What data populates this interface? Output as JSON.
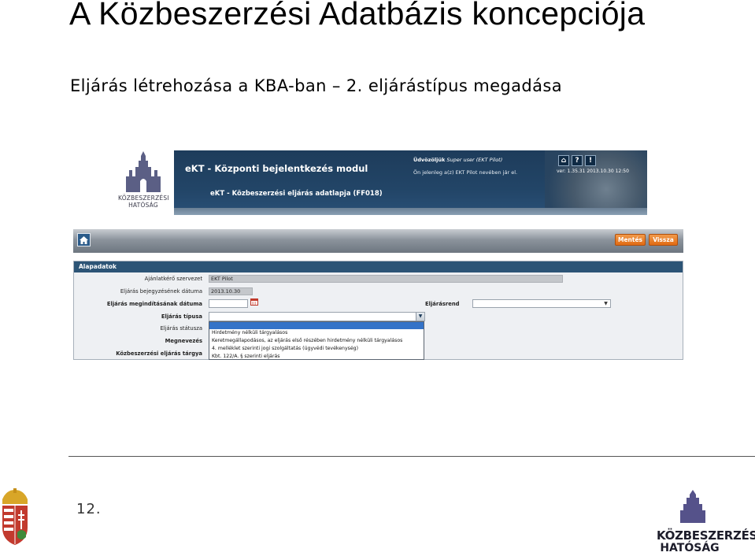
{
  "slide": {
    "title": "A Közbeszerzési Adatbázis koncepciója",
    "subtitle": "Eljárás létrehozása a KBA-ban – 2. eljárástípus megadása",
    "page_number": "12."
  },
  "logo": {
    "line1": "KÖZBESZERZÉSI",
    "line2": "HATÓSÁG"
  },
  "header": {
    "module_title": "eKT - Központi bejelentkezés modul",
    "form_title": "eKT - Közbeszerzési eljárás adatlapja (FF018)",
    "welcome_prefix": "Üdvözöljük",
    "welcome_user": "Super user (EKT Pilot)",
    "on_behalf": "Ön jelenleg a(z) EKT Pilot nevében jár el.",
    "version": "ver: 1.35.31 2013.10.30 12:50",
    "icons": [
      "home-icon",
      "help-icon",
      "alert-icon"
    ],
    "icon_labels": [
      "⌂",
      "?",
      "!"
    ]
  },
  "toolbar": {
    "save_label": "Mentés",
    "back_label": "Vissza"
  },
  "panel": {
    "title": "Alapadatok",
    "fields": {
      "contracting_label": "Ajánlatkérő szervezet",
      "contracting_value": "EKT Pilot",
      "registration_date_label": "Eljárás bejegyzésének dátuma",
      "registration_date_value": "2013.10.30",
      "start_date_label": "Eljárás megindításának dátuma",
      "start_date_value": "",
      "procedure_order_label": "Eljárásrend",
      "procedure_order_value": "",
      "procedure_type_label": "Eljárás típusa",
      "procedure_type_value": "",
      "procedure_status_label": "Eljárás státusza",
      "name_label": "Megnevezés",
      "subject_label": "Közbeszerzési eljárás tárgya"
    }
  },
  "dropdown": {
    "options": [
      "",
      "Hirdetmény nélküli tárgyalásos",
      "Keretmegállapodásos, az eljárás első részében hirdetmény nélküli tárgyalásos",
      "4. melléklet szerinti jogi szolgáltatás (ügyvédi tevékenység)",
      "Kbt. 122/A. § szerinti eljárás"
    ]
  },
  "colors": {
    "banner": "#1e3c5b",
    "panel_header": "#2c5476",
    "button": "#e06b14",
    "selected_option": "#3473c8"
  }
}
